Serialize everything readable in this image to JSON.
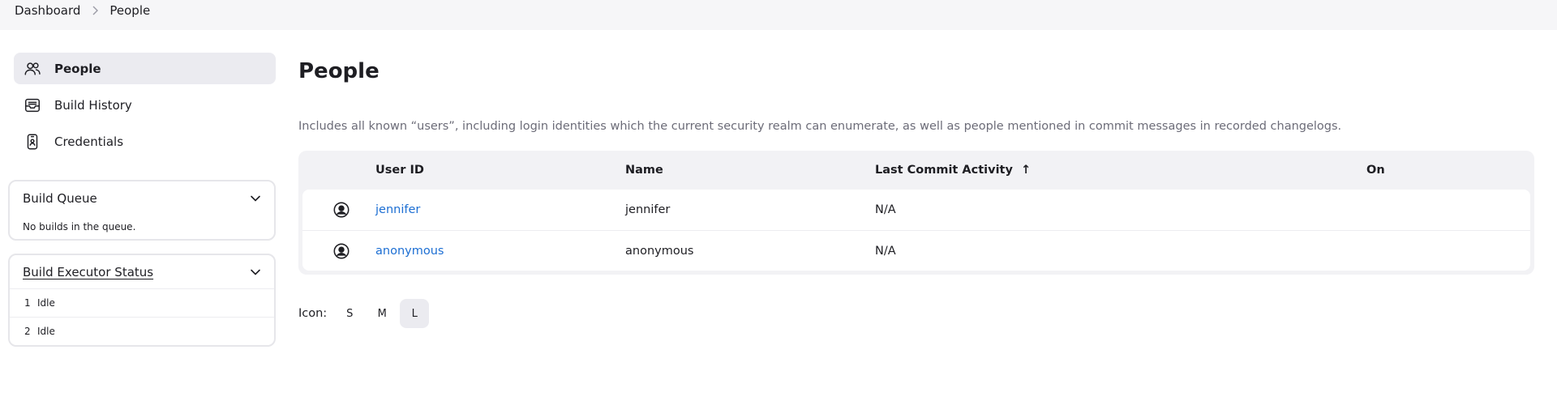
{
  "breadcrumb": {
    "items": [
      "Dashboard",
      "People"
    ]
  },
  "sidebar": {
    "items": [
      {
        "label": "People",
        "icon": "people-icon",
        "active": true
      },
      {
        "label": "Build History",
        "icon": "inbox-icon",
        "active": false
      },
      {
        "label": "Credentials",
        "icon": "phone-id-icon",
        "active": false
      }
    ],
    "build_queue": {
      "title": "Build Queue",
      "empty_text": "No builds in the queue."
    },
    "executor_status": {
      "title": "Build Executor Status",
      "executors": [
        {
          "number": "1",
          "status": "Idle"
        },
        {
          "number": "2",
          "status": "Idle"
        }
      ]
    }
  },
  "main": {
    "title": "People",
    "description": "Includes all known “users”, including login identities which the current security realm can enumerate, as well as people mentioned in commit messages in recorded changelogs.",
    "table": {
      "headers": {
        "user_id": "User ID",
        "name": "Name",
        "last_commit": "Last Commit Activity",
        "sort_indicator": "↑",
        "on": "On"
      },
      "rows": [
        {
          "user_id": "jennifer",
          "name": "jennifer",
          "last_commit": "N/A",
          "on": ""
        },
        {
          "user_id": "anonymous",
          "name": "anonymous",
          "last_commit": "N/A",
          "on": ""
        }
      ]
    },
    "icon_size": {
      "label": "Icon:",
      "options": [
        "S",
        "M",
        "L"
      ],
      "selected": "L"
    }
  },
  "colors": {
    "link": "#1d6fd3",
    "breadcrumb_bg": "#f6f6f8",
    "active_bg": "#ebebf0",
    "muted_text": "#6c6c78"
  }
}
